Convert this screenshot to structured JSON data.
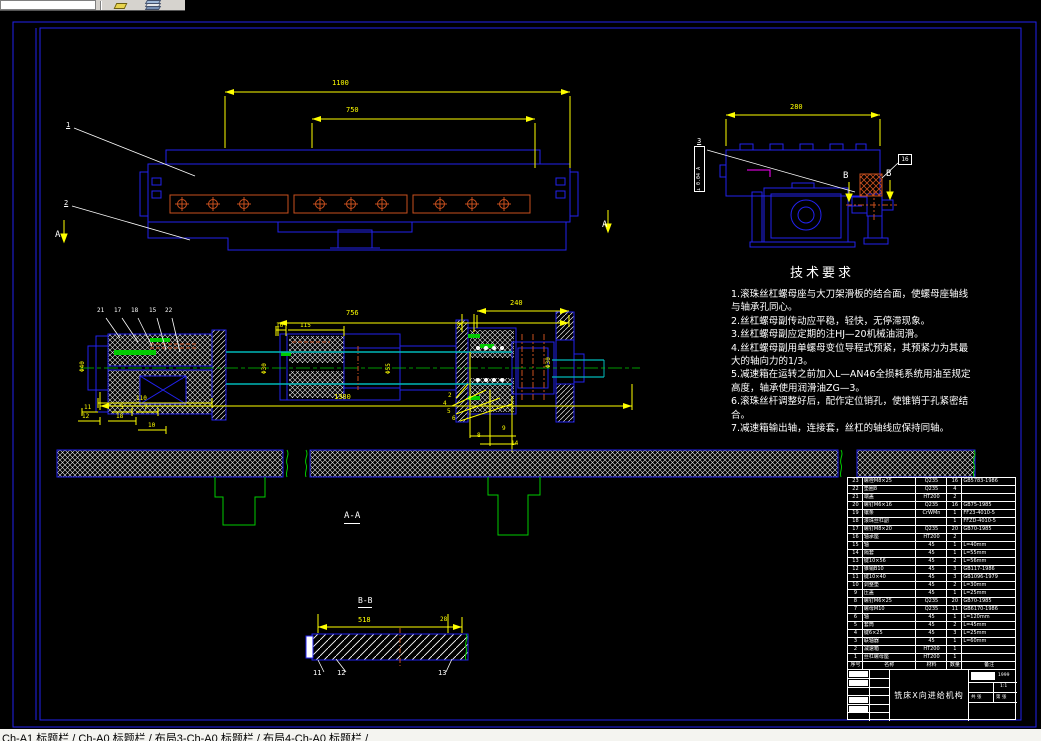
{
  "toolbar": {
    "icons": [
      "make-object-layer-icon",
      "layers-icon"
    ]
  },
  "status_bar": {
    "tabs": "Ch-A1 标题栏 / Ch-A0 标题栏 / 布局3-Ch-A0 标题栏 / 布局4-Ch-A0 标题栏 /"
  },
  "tech_requirements": {
    "title": "技术要求",
    "lines": [
      "1.滚珠丝杠螺母座与大刀架滑板的结合面，使螺母座轴线",
      "与轴承孔同心。",
      "2.丝杠螺母副传动应平稳，轻快，无停滞现象。",
      "3.丝杠螺母副应定期的注HJ—20机械油润滑。",
      "4.丝杠螺母副用单螺母变位导程式预紧，其预紧力为其最",
      "大的轴向力的1/3。",
      "5.减速箱在运转之前加入L—AN46全损耗系统用油至规定",
      "高度，轴承使用润滑油ZG—3。",
      "6.滚珠丝杆调整好后，配作定位销孔，使锥销于孔紧密结",
      "合。",
      "7.减速箱输出轴，连接套，丝杠的轴线应保持同轴。"
    ]
  },
  "labels": {
    "d1100": "1100",
    "d750": "750",
    "d280": "280",
    "d756": "756",
    "d240": "240",
    "d1380": "1380",
    "d23": "23",
    "d16": "16",
    "d115": "115",
    "dia40": "Φ40",
    "dia30a": "Φ30",
    "dia55": "Φ55",
    "dia30b": "Φ30",
    "d110": "110",
    "d11": "11",
    "d12": "12",
    "d5": "5",
    "d7": "7",
    "d18": "18",
    "d10": "10",
    "d518": "518",
    "d28": "28",
    "aa": "A-A",
    "bb": "B-B",
    "a": "A",
    "b": "B",
    "l1": "1",
    "l2": "2",
    "l3": "3",
    "l15": "15",
    "l17": "17",
    "l18": "18",
    "l21": "21",
    "l22": "22",
    "r2": "2",
    "r4": "4",
    "r5": "5",
    "r6": "6",
    "r8": "8",
    "r9": "9",
    "r14": "14",
    "b11": "11",
    "b12": "12",
    "b13": "13",
    "box16": "16",
    "tol": "⊥ 0.04 A"
  },
  "parts_table": {
    "headers": [
      "序号",
      "名称",
      "材料",
      "数量",
      "备注"
    ],
    "rows": [
      [
        "23",
        "螺栓M8×25",
        "Q235",
        "16",
        "GB5783-1986"
      ],
      [
        "22",
        "垫圈8",
        "Q235",
        "4",
        ""
      ],
      [
        "21",
        "端盖",
        "HT200",
        "2",
        ""
      ],
      [
        "20",
        "螺钉M6×16",
        "Q235",
        "16",
        "GB75-1985"
      ],
      [
        "19",
        "镶条",
        "CrWMn",
        "1",
        "FF23-4010-5"
      ],
      [
        "18",
        "滚珠丝杠副",
        "",
        "1",
        "FFZD-4010-5"
      ],
      [
        "17",
        "螺钉M8×20",
        "Q235",
        "20",
        "GB70-1985"
      ],
      [
        "16",
        "轴承座",
        "HT200",
        "2",
        ""
      ],
      [
        "15",
        "轴",
        "45",
        "1",
        "L=40mm"
      ],
      [
        "14",
        "隔套",
        "45",
        "1",
        "L=55mm"
      ],
      [
        "13",
        "键10×56",
        "45",
        "2",
        "L=56mm"
      ],
      [
        "12",
        "锥销B10",
        "45",
        "3",
        "GB117-1986"
      ],
      [
        "11",
        "键10×40",
        "45",
        "3",
        "GB1096-1979"
      ],
      [
        "10",
        "调整垫",
        "45",
        "2",
        "L=30mm"
      ],
      [
        "9",
        "压盖",
        "45",
        "1",
        "L=25mm"
      ],
      [
        "8",
        "螺钉M6×25",
        "Q235",
        "20",
        "GB70-1985"
      ],
      [
        "7",
        "螺母M10",
        "Q235",
        "11",
        "GB6170-1986"
      ],
      [
        "6",
        "轴",
        "45",
        "1",
        "L=120mm"
      ],
      [
        "5",
        "套筒",
        "45",
        "2",
        "L=45mm"
      ],
      [
        "4",
        "键6×25",
        "45",
        "3",
        "L=25mm"
      ],
      [
        "3",
        "联轴器",
        "45",
        "1",
        "L=60mm"
      ],
      [
        "2",
        "减速箱",
        "HT200",
        "1",
        ""
      ],
      [
        "1",
        "丝杠螺母座",
        "HT200",
        "1",
        ""
      ]
    ]
  },
  "title_block": {
    "title": "铣床X向进给机构",
    "doc_code": "1999",
    "scale": "1:1",
    "sheet_total": "共 张",
    "sheet_index": "第 张"
  },
  "colors": {
    "line_blue": "#2222ee",
    "dim_yellow": "#ffff00",
    "text_white": "#ffffff",
    "hidden_orange": "#c8501e",
    "center_green": "#00cc00",
    "shaft_cyan": "#00b8b8",
    "magenta": "#ff00ff"
  }
}
